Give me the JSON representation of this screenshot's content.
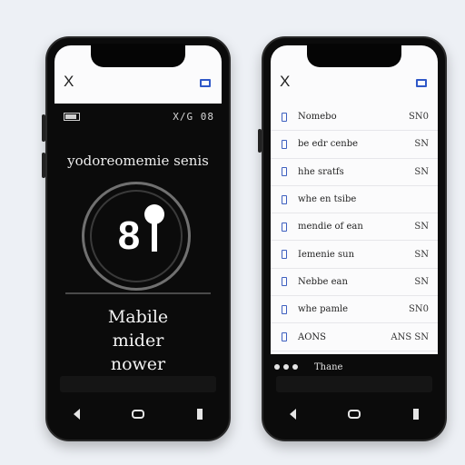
{
  "left_phone": {
    "close_glyph": "X",
    "status_text": "X/G 08",
    "lead_title": "yodoreomemie senis",
    "ring_number": "8",
    "big_text": [
      "Mabile",
      "mider",
      "nower"
    ]
  },
  "right_phone": {
    "close_glyph": "X",
    "rows": [
      {
        "label": "Nomebo",
        "value": "SN0"
      },
      {
        "label": "be edr cenbe",
        "value": "SN"
      },
      {
        "label": "hhe sratfs",
        "value": "SN"
      },
      {
        "label": "whe en tsibe",
        "value": ""
      },
      {
        "label": "mendie of ean",
        "value": "SN"
      },
      {
        "label": "Iemenie sun",
        "value": "SN"
      },
      {
        "label": "Nebbe ean",
        "value": "SN"
      },
      {
        "label": "whe pamle",
        "value": "SN0"
      },
      {
        "label": "AONS",
        "value": "ANS SN"
      }
    ],
    "strip_label": "Thane"
  },
  "icons": {
    "close": "close-icon",
    "tab": "tab-switcher-icon",
    "battery": "battery-icon",
    "back": "back-nav-icon",
    "home": "home-nav-icon",
    "recent": "recent-apps-icon",
    "row": "document-icon"
  },
  "colors": {
    "accent": "#2f58c8",
    "phone_body": "#0b0b0b",
    "background": "#edf0f5"
  }
}
